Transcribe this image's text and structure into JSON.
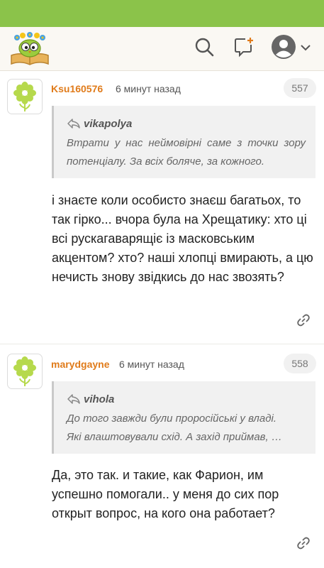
{
  "header": {
    "logo": "owl-on-book-logo",
    "search_icon": "search-icon",
    "add_comment_icon": "add-comment-icon",
    "profile_icon": "user-avatar-icon",
    "accent_color": "#8bc34a"
  },
  "comments": [
    {
      "username": "Ksu160576",
      "time": "6 минут назад",
      "number": "557",
      "quote": {
        "author": "vikapolya",
        "text": "Втрати у нас неймовірні саме з точки зору потенціалу. За всіх боляче, за кожного."
      },
      "body": "і знаєте коли особисто знаєш багатьох, то так гірко... вчора була на Хрещатику: хто ці всі рускагаварящіє із масковським акцентом? хто? наші хлопці вмирають, а цю нечисть знову звідкись до нас звозять?"
    },
    {
      "username": "marydgayne",
      "time": "6 минут назад",
      "number": "558",
      "quote": {
        "author": "vihola",
        "text_line1": "До того завжди були проросійські у владі.",
        "text_line2": "Які влаштовували схід. А захід приймав, …"
      },
      "body": "Да, это так. и такие, как Фарион, им успешно помогали.. у меня до сих пор открыт вопрос, на кого она работает?"
    }
  ]
}
